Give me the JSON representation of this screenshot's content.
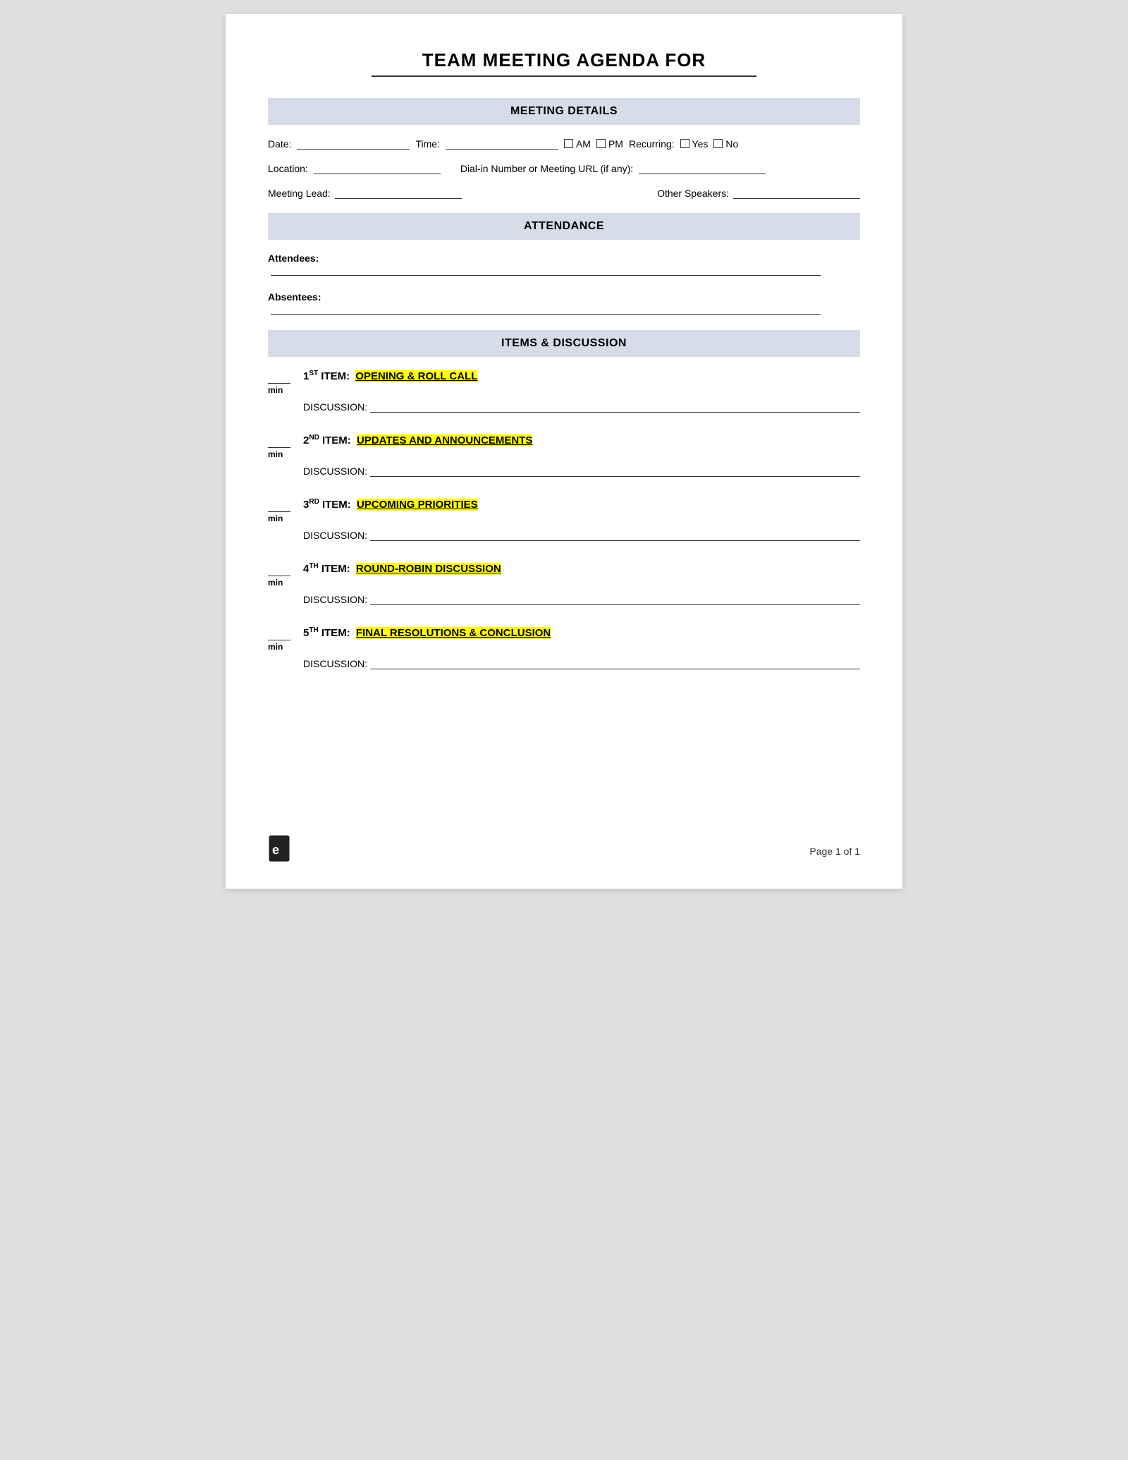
{
  "title": {
    "main": "TEAM MEETING AGENDA FOR"
  },
  "sections": {
    "meeting_details": {
      "header": "MEETING DETAILS",
      "fields": {
        "date_label": "Date:",
        "time_label": "Time:",
        "am_label": "AM",
        "pm_label": "PM",
        "recurring_label": "Recurring:",
        "yes_label": "Yes",
        "no_label": "No",
        "location_label": "Location:",
        "dialin_label": "Dial-in Number or Meeting URL (if any):",
        "meeting_lead_label": "Meeting Lead:",
        "other_speakers_label": "Other Speakers:"
      }
    },
    "attendance": {
      "header": "ATTENDANCE",
      "attendees_label": "Attendees:",
      "absentees_label": "Absentees"
    },
    "items_discussion": {
      "header": "ITEMS & DISCUSSION",
      "items": [
        {
          "number": "1",
          "ordinal": "ST",
          "title": "OPENING & ROLL CALL",
          "discussion_label": "DISCUSSION:"
        },
        {
          "number": "2",
          "ordinal": "ND",
          "title": "UPDATES AND ANNOUNCEMENTS",
          "discussion_label": "DISCUSSION:"
        },
        {
          "number": "3",
          "ordinal": "RD",
          "title": "UPCOMING PRIORITIES",
          "discussion_label": "DISCUSSION:"
        },
        {
          "number": "4",
          "ordinal": "TH",
          "title": "ROUND-ROBIN DISCUSSION",
          "discussion_label": "DISCUSSION:"
        },
        {
          "number": "5",
          "ordinal": "TH",
          "title": "FINAL RESOLUTIONS & CONCLUSION",
          "discussion_label": "DISCUSSION:"
        }
      ],
      "min_label": "min"
    }
  },
  "footer": {
    "page_label": "Page 1 of 1"
  }
}
